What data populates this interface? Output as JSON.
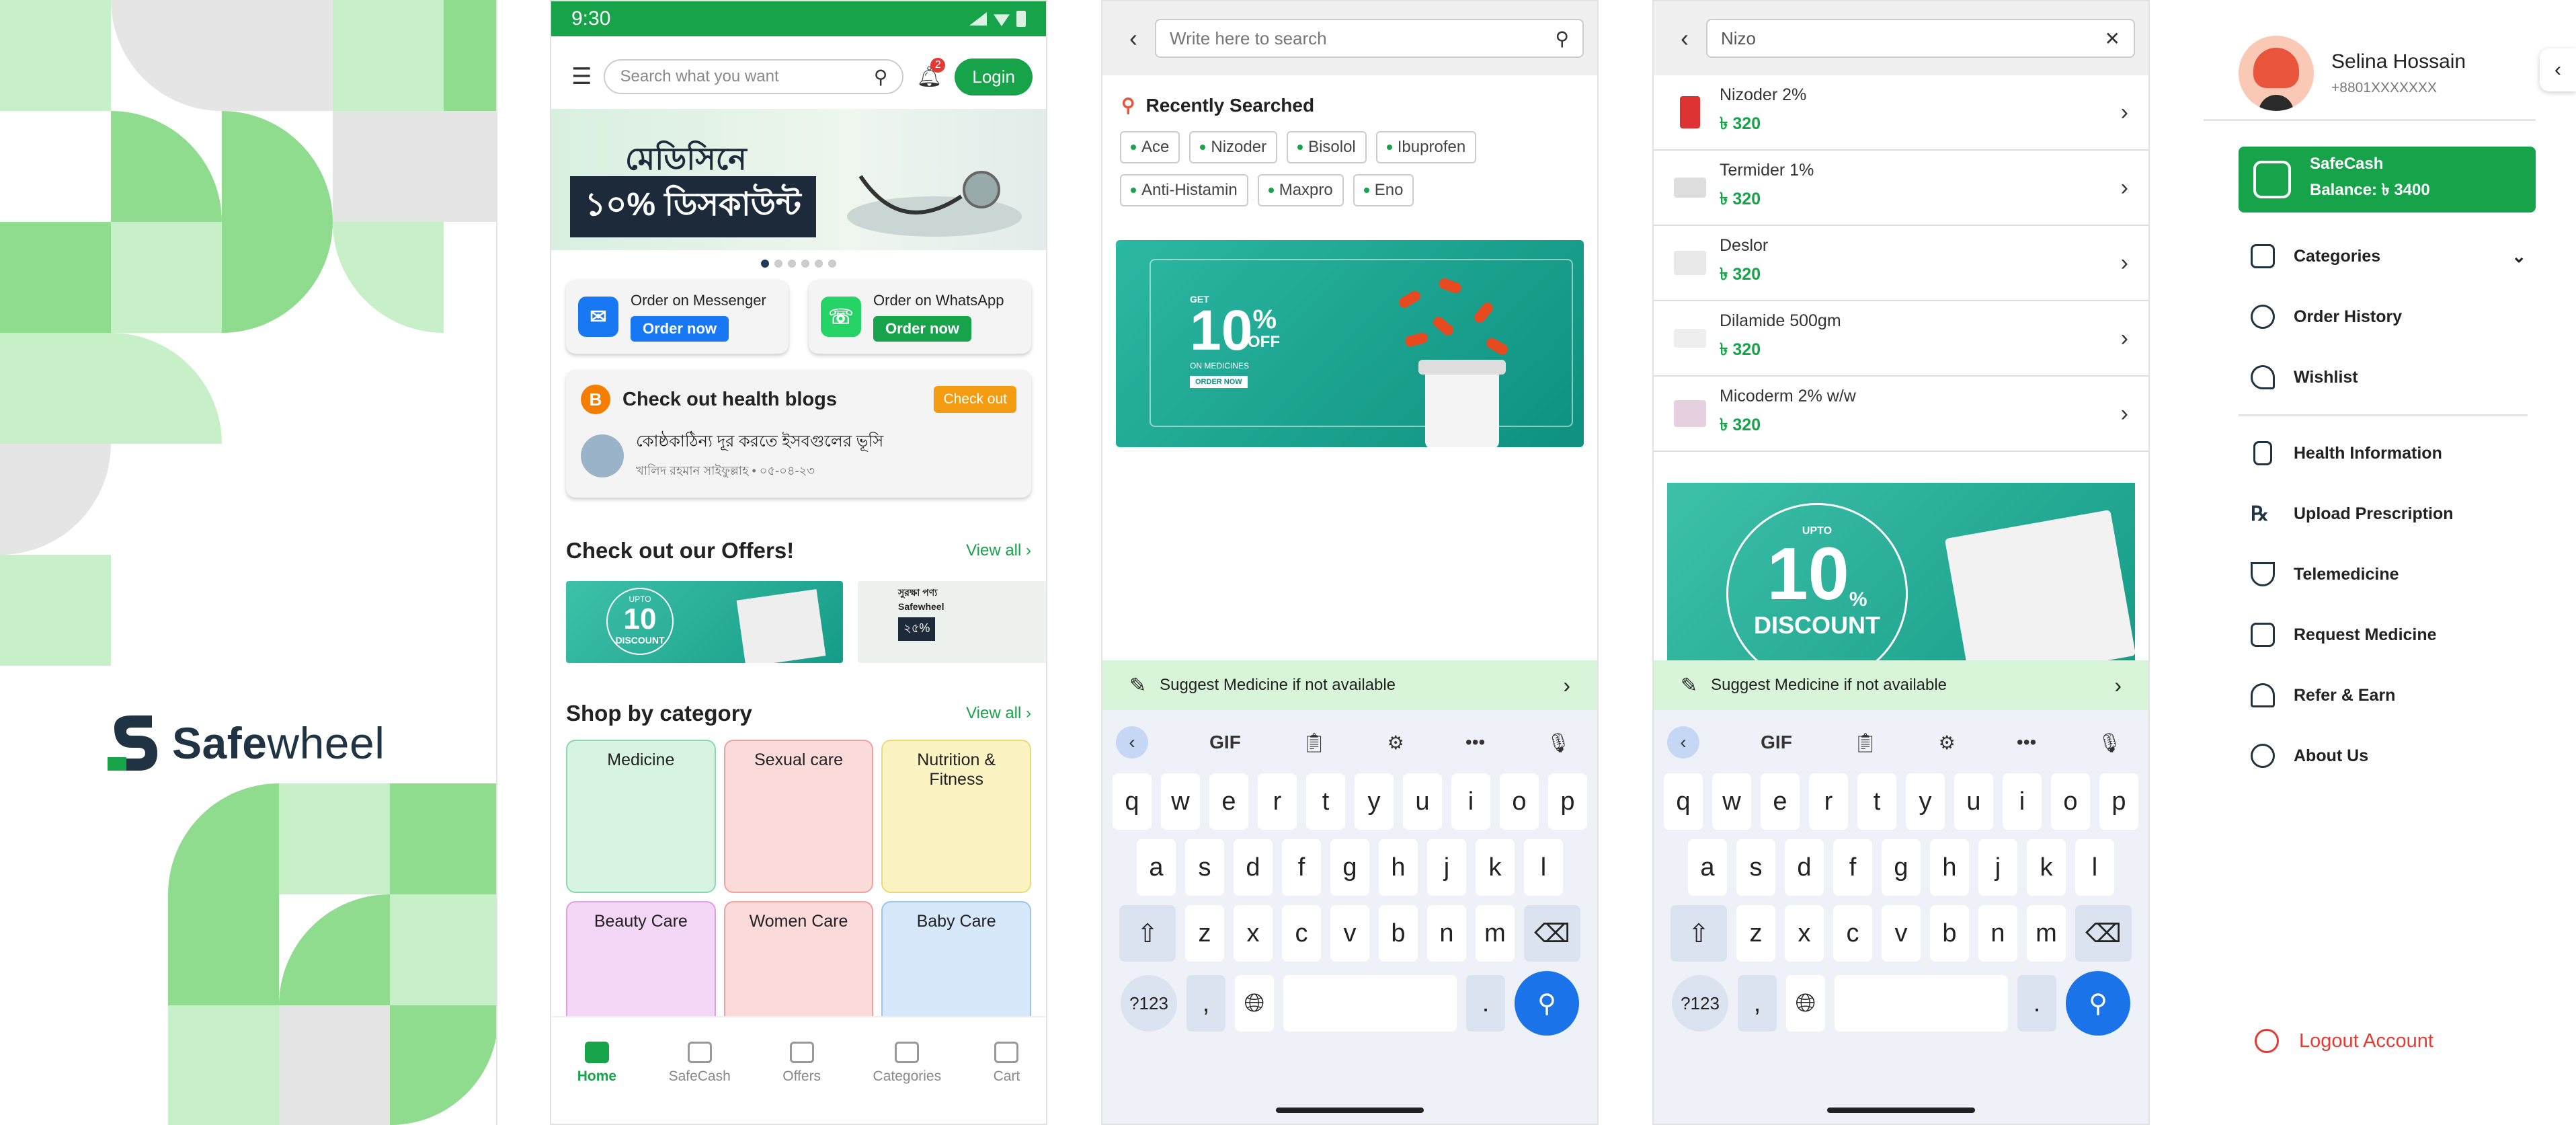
{
  "splash": {
    "brand_bold": "Safe",
    "brand_light": "wheel",
    "colors": {
      "green_dark": "#8fdc8f",
      "green_light": "#c8f0c8",
      "gray": "#e5e5e5"
    }
  },
  "home": {
    "status_time": "9:30",
    "search_placeholder": "Search what you want",
    "notification_count": "2",
    "login_label": "Login",
    "banner": {
      "line1": "মেডিসিনে",
      "line2": "১০% ডিসকাউন্ট"
    },
    "order_messenger": {
      "title": "Order on Messenger",
      "button": "Order now"
    },
    "order_whatsapp": {
      "title": "Order on WhatsApp",
      "button": "Order now"
    },
    "blog": {
      "title": "Check out health blogs",
      "button": "Check out",
      "post_title": "কোষ্ঠকাঠিন্য দূর করতে ইসবগুলের ভূসি",
      "post_meta": "খালিদ রহমান সাইফুল্লাহ • ০৫-০৪-২৩"
    },
    "offers": {
      "title": "Check out our Offers!",
      "view_all": "View all",
      "offer1_top": "UPTO",
      "offer1_big": "10",
      "offer1_bottom": "DISCOUNT",
      "offer2_title": "সুরক্ষা পণ্য",
      "offer2_brand": "Safewheel",
      "offer2_pct": "২৫%"
    },
    "category": {
      "title": "Shop by category",
      "view_all": "View all",
      "items": [
        {
          "label": "Medicine",
          "color": "#d7f4e3"
        },
        {
          "label": "Sexual care",
          "color": "#fbdada"
        },
        {
          "label": "Nutrition & Fitness",
          "color": "#fcf3c2"
        },
        {
          "label": "Beauty Care",
          "color": "#f4d6f6"
        },
        {
          "label": "Women Care",
          "color": "#fbdada"
        },
        {
          "label": "Baby Care",
          "color": "#d7e8fb"
        }
      ]
    },
    "nav": [
      "Home",
      "SafeCash",
      "Offers",
      "Categories",
      "Cart"
    ]
  },
  "search1": {
    "placeholder": "Write here to search",
    "recent_title": "Recently Searched",
    "chips": [
      "Ace",
      "Nizoder",
      "Bisolol",
      "Ibuprofen",
      "Anti-Histamin",
      "Maxpro",
      "Eno"
    ],
    "offer": {
      "get": "GET",
      "pct": "10",
      "off": "OFF",
      "sub": "ON MEDICINES",
      "cta": "ORDER NOW"
    },
    "suggest": "Suggest Medicine if not available"
  },
  "search2": {
    "query": "Nizo",
    "results": [
      {
        "name": "Nizoder 2%",
        "price": "৳ 320"
      },
      {
        "name": "Termider 1%",
        "price": "৳ 320"
      },
      {
        "name": "Deslor",
        "price": "৳ 320"
      },
      {
        "name": "Dilamide 500gm",
        "price": "৳ 320"
      },
      {
        "name": "Micoderm 2% w/w",
        "price": "৳ 320"
      }
    ],
    "offer": {
      "top": "UPTO",
      "big": "10",
      "pct": "%",
      "bottom": "DISCOUNT"
    },
    "suggest": "Suggest Medicine if not available"
  },
  "keyboard": {
    "gif": "GIF",
    "row1": [
      "q",
      "w",
      "e",
      "r",
      "t",
      "y",
      "u",
      "i",
      "o",
      "p"
    ],
    "row2": [
      "a",
      "s",
      "d",
      "f",
      "g",
      "h",
      "j",
      "k",
      "l"
    ],
    "row3": [
      "z",
      "x",
      "c",
      "v",
      "b",
      "n",
      "m"
    ],
    "sym": "?123",
    "comma": ",",
    "period": "."
  },
  "drawer": {
    "name": "Selina Hossain",
    "phone": "+8801XXXXXXX",
    "cash_title": "SafeCash",
    "cash_balance": "Balance:  ৳ 3400",
    "menu1": [
      "Categories",
      "Order History",
      "Wishlist"
    ],
    "menu2": [
      "Health Information",
      "Upload Prescription",
      "Telemedicine",
      "Request Medicine",
      "Refer & Earn",
      "About Us"
    ],
    "logout": "Logout Account"
  }
}
